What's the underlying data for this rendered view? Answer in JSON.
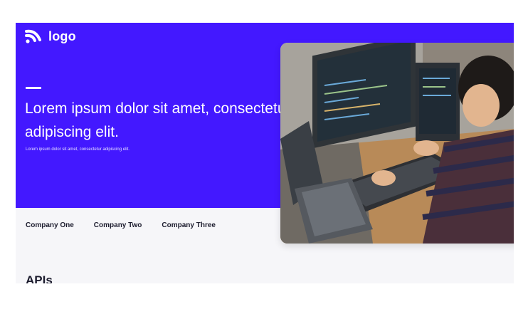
{
  "header": {
    "logo_text": "logo",
    "nav": {
      "items": [
        "",
        "",
        "",
        "",
        ""
      ],
      "button_label": "",
      "extra": ""
    }
  },
  "hero": {
    "headline": "Lorem ipsum dolor sit amet, consectetur adipiscing elit.",
    "subtext": "Lorem ipsum dolor sit amet, consectetur adipiscing elit.",
    "image_description": "developer working at desk with multiple monitors and laptop"
  },
  "companies": [
    "Company One",
    "Company Two",
    "Company Three"
  ],
  "section": {
    "title": "APIs"
  },
  "colors": {
    "brand": "#4318ff",
    "page_background": "#f6f6f9",
    "text_dark": "#1c1c2e"
  }
}
